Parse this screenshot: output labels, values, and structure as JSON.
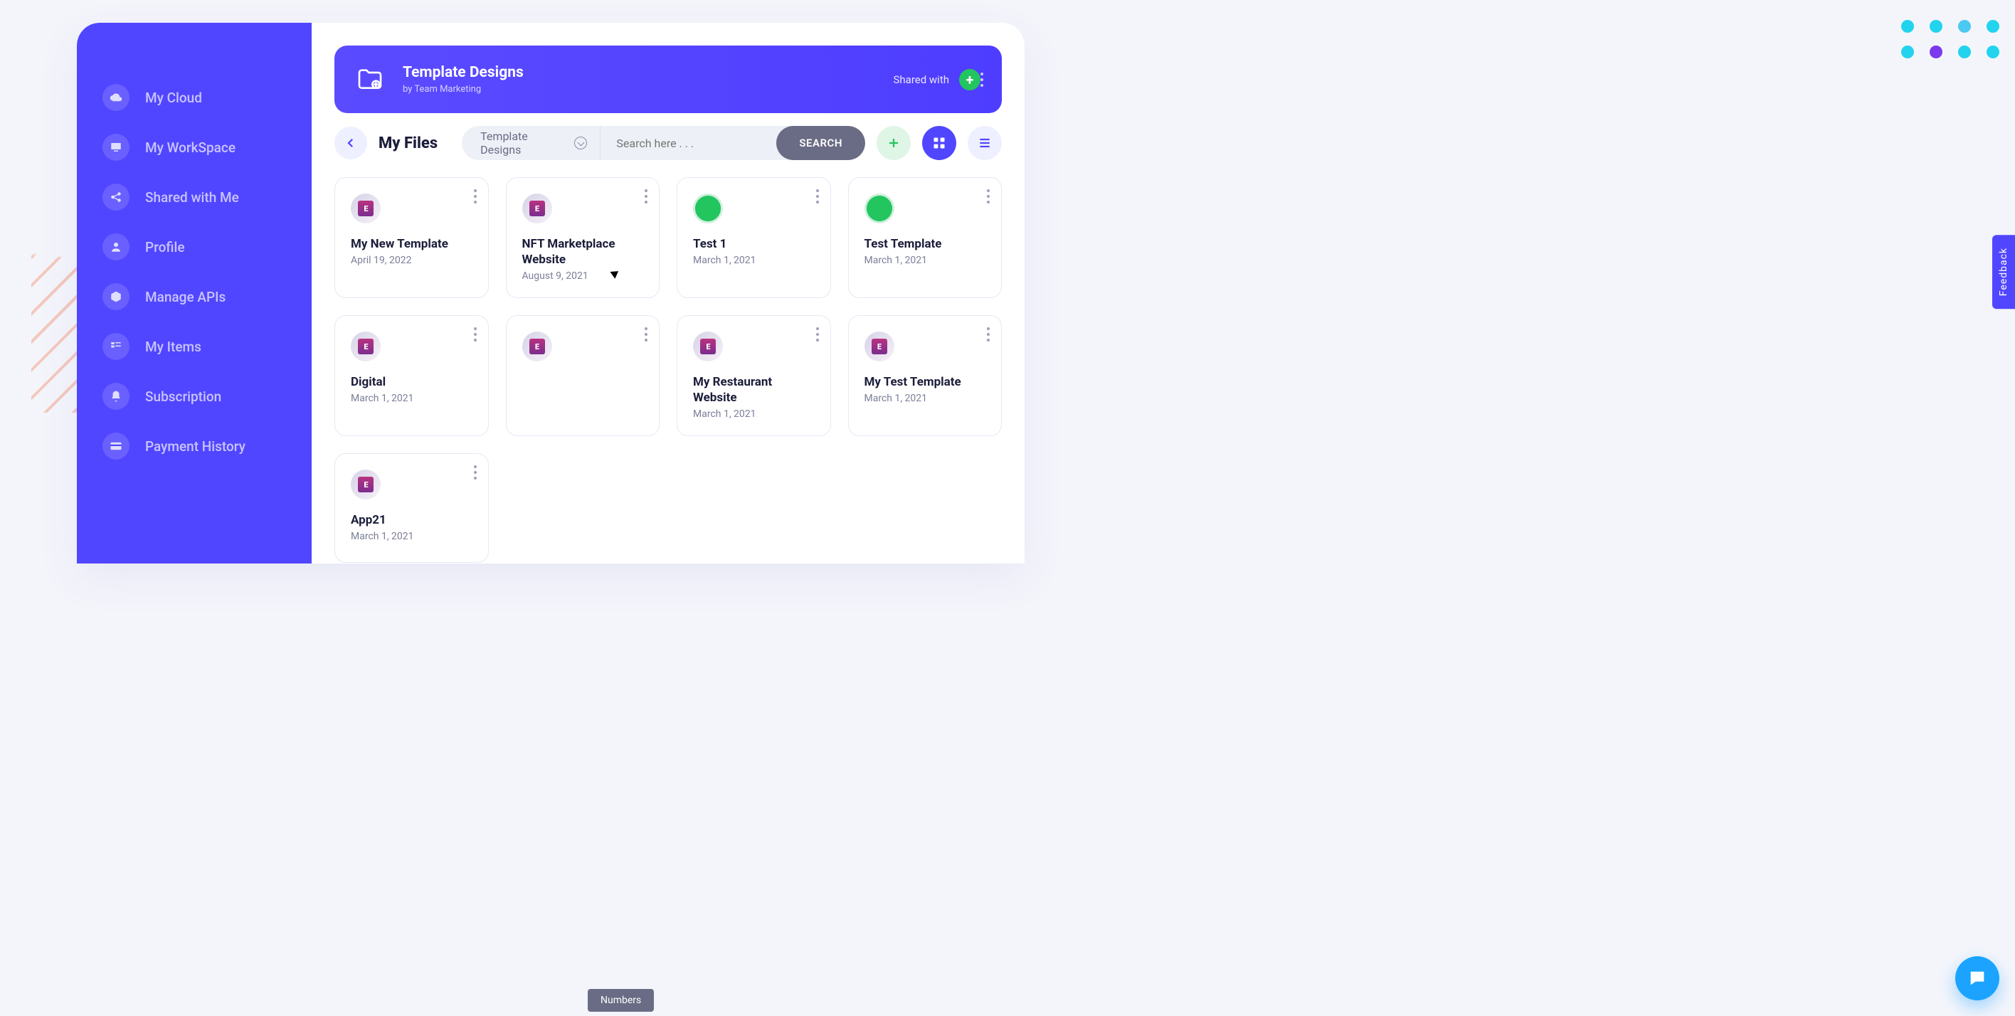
{
  "sidebar": {
    "items": [
      {
        "label": "My Cloud",
        "icon": "cloud"
      },
      {
        "label": "My WorkSpace",
        "icon": "workspace"
      },
      {
        "label": "Shared with Me",
        "icon": "share"
      },
      {
        "label": "Profile",
        "icon": "user"
      },
      {
        "label": "Manage APIs",
        "icon": "cube"
      },
      {
        "label": "My Items",
        "icon": "list"
      },
      {
        "label": "Subscription",
        "icon": "bell"
      },
      {
        "label": "Payment History",
        "icon": "card"
      }
    ]
  },
  "banner": {
    "title": "Template Designs",
    "subtitle": "by Team Marketing",
    "shared_label": "Shared with"
  },
  "toolbar": {
    "section_title": "My Files",
    "filter_label": "Template Designs",
    "search_placeholder": "Search here . . .",
    "search_button": "SEARCH"
  },
  "cards": [
    {
      "title": "My New Template",
      "date": "April 19, 2022",
      "icon": "el"
    },
    {
      "title": "NFT Marketplace Website",
      "date": "August 9, 2021",
      "icon": "el"
    },
    {
      "title": "Test 1",
      "date": "March 1, 2021",
      "icon": "gr"
    },
    {
      "title": "Test Template",
      "date": "March 1, 2021",
      "icon": "gr"
    },
    {
      "title": "Digital",
      "date": "March 1, 2021",
      "icon": "el"
    },
    {
      "title": "",
      "date": "",
      "icon": "el"
    },
    {
      "title": "My Restaurant Website",
      "date": "March 1, 2021",
      "icon": "el"
    },
    {
      "title": "My Test Template",
      "date": "March 1, 2021",
      "icon": "el"
    },
    {
      "title": "App21",
      "date": "March 1, 2021",
      "icon": "el"
    }
  ],
  "tooltip": "Numbers",
  "feedback_label": "Feedback"
}
